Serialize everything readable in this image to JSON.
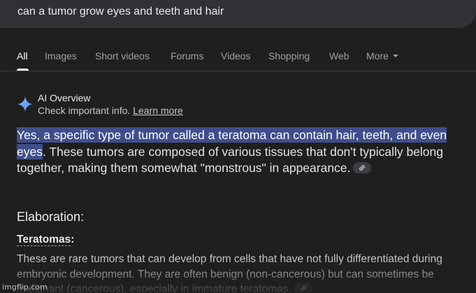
{
  "search": {
    "query": "can a tumor grow eyes and teeth and hair"
  },
  "tabs": [
    {
      "label": "All",
      "active": true
    },
    {
      "label": "Images"
    },
    {
      "label": "Short videos"
    },
    {
      "label": "Forums"
    },
    {
      "label": "Videos"
    },
    {
      "label": "Shopping"
    },
    {
      "label": "Web"
    },
    {
      "label": "More"
    }
  ],
  "ai_overview": {
    "icon": "sparkle-icon",
    "title": "AI Overview",
    "subtitle": "Check important info.",
    "learn_more": "Learn more",
    "answer_highlight": "Yes, a specific type of tumor called a teratoma can contain hair, teeth, and even eyes",
    "answer_rest": ". These tumors are composed of various tissues that don't typically belong together, making them somewhat \"monstrous\" in appearance.",
    "elaboration_heading": "Elaboration:",
    "subheading": "Teratomas",
    "subheading_colon": ":",
    "body": "These are rare tumors that can develop from cells that have not fully differentiated during embryonic development. They are often benign (non-cancerous) but can sometimes be malignant (cancerous), especially in immature teratomas."
  },
  "colors": {
    "background": "#1f1f1f",
    "highlight": "#3f4e8a",
    "accent": "#8ab4f8"
  },
  "watermark": "imgflip.com"
}
